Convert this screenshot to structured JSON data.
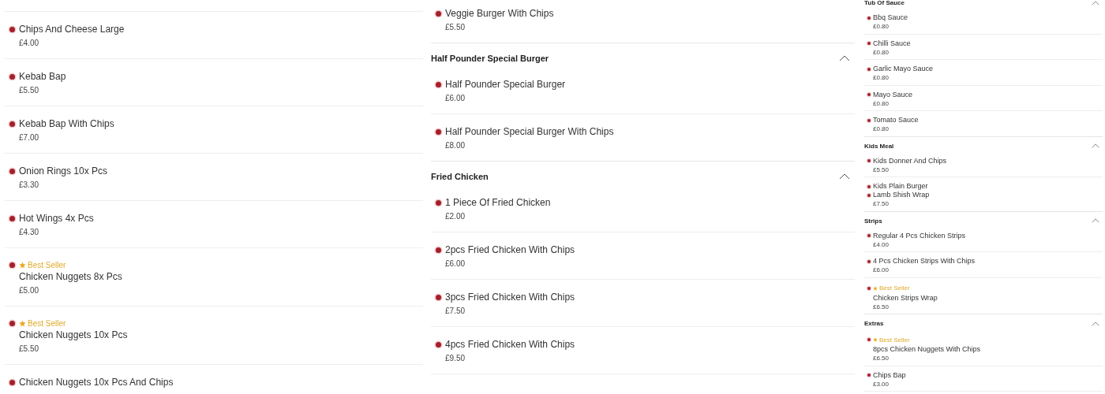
{
  "panels": [
    {
      "entries": [
        {
          "kind": "item",
          "name": "Chips And Cheese Large",
          "price": "£4.00"
        },
        {
          "kind": "item",
          "name": "Kebab Bap",
          "price": "£5.50"
        },
        {
          "kind": "item",
          "name": "Kebab Bap With Chips",
          "price": "£7.00"
        },
        {
          "kind": "item",
          "name": "Onion Rings 10x Pcs",
          "price": "£3.30"
        },
        {
          "kind": "item",
          "name": "Hot Wings 4x Pcs",
          "price": "£4.30"
        },
        {
          "kind": "item",
          "badge": "Best Seller",
          "name": "Chicken Nuggets 8x Pcs",
          "price": "£5.00"
        },
        {
          "kind": "item",
          "badge": "Best Seller",
          "name": "Chicken Nuggets 10x Pcs",
          "price": "£5.50"
        },
        {
          "kind": "item",
          "name": "Chicken Nuggets 10x Pcs And Chips"
        }
      ]
    },
    {
      "entries": [
        {
          "kind": "item",
          "name": "Veggie Burger With Chips",
          "price": "£5.50"
        },
        {
          "kind": "header",
          "title": "Half Pounder Special Burger",
          "expanded": true
        },
        {
          "kind": "item",
          "name": "Half Pounder Special Burger",
          "price": "£6.00"
        },
        {
          "kind": "item",
          "name": "Half Pounder Special Burger With Chips",
          "price": "£8.00"
        },
        {
          "kind": "header",
          "title": "Fried Chicken",
          "expanded": true
        },
        {
          "kind": "item",
          "name": "1 Piece Of Fried Chicken",
          "price": "£2.00"
        },
        {
          "kind": "item",
          "name": "2pcs Fried Chicken With Chips",
          "price": "£6.00"
        },
        {
          "kind": "item",
          "name": "3pcs Fried Chicken With Chips",
          "price": "£7.50"
        },
        {
          "kind": "item",
          "name": "4pcs Fried Chicken With Chips",
          "price": "£9.50"
        }
      ]
    },
    {
      "entries": [
        {
          "kind": "header",
          "title": "Tub Of Sauce",
          "expanded": true
        },
        {
          "kind": "item",
          "name": "Bbq Sauce",
          "price": "£0.80"
        },
        {
          "kind": "item",
          "name": "Chilli Sauce",
          "price": "£0.80"
        },
        {
          "kind": "item",
          "name": "Garlic Mayo Sauce",
          "price": "£0.80"
        },
        {
          "kind": "item",
          "name": "Mayo Sauce",
          "price": "£0.80"
        },
        {
          "kind": "item",
          "name": "Tomato Sauce",
          "price": "£0.80"
        },
        {
          "kind": "header",
          "title": "Kids Meal",
          "expanded": true
        },
        {
          "kind": "item",
          "name": "Kids Donner And Chips",
          "price": "£5.50"
        },
        {
          "kind": "partial",
          "name": "Kids Plain Burger"
        },
        {
          "kind": "item",
          "name": "Lamb Shish Wrap",
          "price": "£7.50"
        },
        {
          "kind": "header",
          "title": "Strips",
          "expanded": true
        },
        {
          "kind": "item",
          "name": "Regular 4 Pcs Chicken Strips",
          "price": "£4.00"
        },
        {
          "kind": "item",
          "name": "4 Pcs Chicken Strips With Chips",
          "price": "£6.00"
        },
        {
          "kind": "item",
          "badge": "Best Seller",
          "name": "Chicken Strips Wrap",
          "price": "£6.50"
        },
        {
          "kind": "header",
          "title": "Extras",
          "expanded": true
        },
        {
          "kind": "item",
          "badge": "Best Seller",
          "name": "8pcs Chicken Nuggets With Chips",
          "price": "£6.50"
        },
        {
          "kind": "item",
          "name": "Chips Bap",
          "price": "£3.00"
        }
      ]
    }
  ]
}
